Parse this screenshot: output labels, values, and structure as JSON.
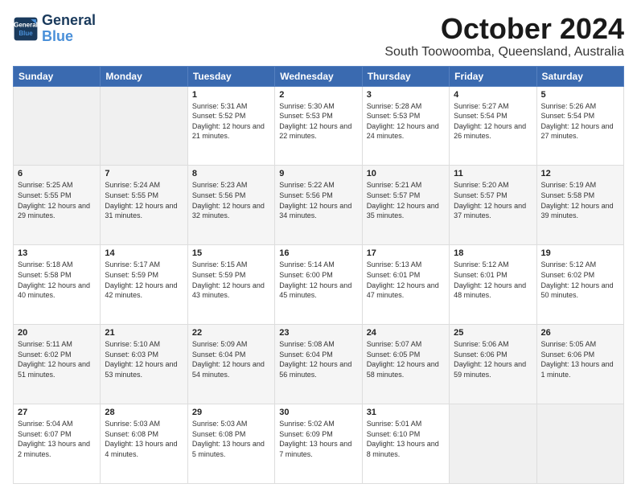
{
  "header": {
    "logo_line1": "General",
    "logo_line2": "Blue",
    "month": "October 2024",
    "location": "South Toowoomba, Queensland, Australia"
  },
  "weekdays": [
    "Sunday",
    "Monday",
    "Tuesday",
    "Wednesday",
    "Thursday",
    "Friday",
    "Saturday"
  ],
  "weeks": [
    [
      {
        "day": "",
        "empty": true
      },
      {
        "day": "",
        "empty": true
      },
      {
        "day": "1",
        "sunrise": "5:31 AM",
        "sunset": "5:52 PM",
        "daylight": "12 hours and 21 minutes."
      },
      {
        "day": "2",
        "sunrise": "5:30 AM",
        "sunset": "5:53 PM",
        "daylight": "12 hours and 22 minutes."
      },
      {
        "day": "3",
        "sunrise": "5:28 AM",
        "sunset": "5:53 PM",
        "daylight": "12 hours and 24 minutes."
      },
      {
        "day": "4",
        "sunrise": "5:27 AM",
        "sunset": "5:54 PM",
        "daylight": "12 hours and 26 minutes."
      },
      {
        "day": "5",
        "sunrise": "5:26 AM",
        "sunset": "5:54 PM",
        "daylight": "12 hours and 27 minutes."
      }
    ],
    [
      {
        "day": "6",
        "sunrise": "5:25 AM",
        "sunset": "5:55 PM",
        "daylight": "12 hours and 29 minutes."
      },
      {
        "day": "7",
        "sunrise": "5:24 AM",
        "sunset": "5:55 PM",
        "daylight": "12 hours and 31 minutes."
      },
      {
        "day": "8",
        "sunrise": "5:23 AM",
        "sunset": "5:56 PM",
        "daylight": "12 hours and 32 minutes."
      },
      {
        "day": "9",
        "sunrise": "5:22 AM",
        "sunset": "5:56 PM",
        "daylight": "12 hours and 34 minutes."
      },
      {
        "day": "10",
        "sunrise": "5:21 AM",
        "sunset": "5:57 PM",
        "daylight": "12 hours and 35 minutes."
      },
      {
        "day": "11",
        "sunrise": "5:20 AM",
        "sunset": "5:57 PM",
        "daylight": "12 hours and 37 minutes."
      },
      {
        "day": "12",
        "sunrise": "5:19 AM",
        "sunset": "5:58 PM",
        "daylight": "12 hours and 39 minutes."
      }
    ],
    [
      {
        "day": "13",
        "sunrise": "5:18 AM",
        "sunset": "5:58 PM",
        "daylight": "12 hours and 40 minutes."
      },
      {
        "day": "14",
        "sunrise": "5:17 AM",
        "sunset": "5:59 PM",
        "daylight": "12 hours and 42 minutes."
      },
      {
        "day": "15",
        "sunrise": "5:15 AM",
        "sunset": "5:59 PM",
        "daylight": "12 hours and 43 minutes."
      },
      {
        "day": "16",
        "sunrise": "5:14 AM",
        "sunset": "6:00 PM",
        "daylight": "12 hours and 45 minutes."
      },
      {
        "day": "17",
        "sunrise": "5:13 AM",
        "sunset": "6:01 PM",
        "daylight": "12 hours and 47 minutes."
      },
      {
        "day": "18",
        "sunrise": "5:12 AM",
        "sunset": "6:01 PM",
        "daylight": "12 hours and 48 minutes."
      },
      {
        "day": "19",
        "sunrise": "5:12 AM",
        "sunset": "6:02 PM",
        "daylight": "12 hours and 50 minutes."
      }
    ],
    [
      {
        "day": "20",
        "sunrise": "5:11 AM",
        "sunset": "6:02 PM",
        "daylight": "12 hours and 51 minutes."
      },
      {
        "day": "21",
        "sunrise": "5:10 AM",
        "sunset": "6:03 PM",
        "daylight": "12 hours and 53 minutes."
      },
      {
        "day": "22",
        "sunrise": "5:09 AM",
        "sunset": "6:04 PM",
        "daylight": "12 hours and 54 minutes."
      },
      {
        "day": "23",
        "sunrise": "5:08 AM",
        "sunset": "6:04 PM",
        "daylight": "12 hours and 56 minutes."
      },
      {
        "day": "24",
        "sunrise": "5:07 AM",
        "sunset": "6:05 PM",
        "daylight": "12 hours and 58 minutes."
      },
      {
        "day": "25",
        "sunrise": "5:06 AM",
        "sunset": "6:06 PM",
        "daylight": "12 hours and 59 minutes."
      },
      {
        "day": "26",
        "sunrise": "5:05 AM",
        "sunset": "6:06 PM",
        "daylight": "13 hours and 1 minute."
      }
    ],
    [
      {
        "day": "27",
        "sunrise": "5:04 AM",
        "sunset": "6:07 PM",
        "daylight": "13 hours and 2 minutes."
      },
      {
        "day": "28",
        "sunrise": "5:03 AM",
        "sunset": "6:08 PM",
        "daylight": "13 hours and 4 minutes."
      },
      {
        "day": "29",
        "sunrise": "5:03 AM",
        "sunset": "6:08 PM",
        "daylight": "13 hours and 5 minutes."
      },
      {
        "day": "30",
        "sunrise": "5:02 AM",
        "sunset": "6:09 PM",
        "daylight": "13 hours and 7 minutes."
      },
      {
        "day": "31",
        "sunrise": "5:01 AM",
        "sunset": "6:10 PM",
        "daylight": "13 hours and 8 minutes."
      },
      {
        "day": "",
        "empty": true
      },
      {
        "day": "",
        "empty": true
      }
    ]
  ]
}
